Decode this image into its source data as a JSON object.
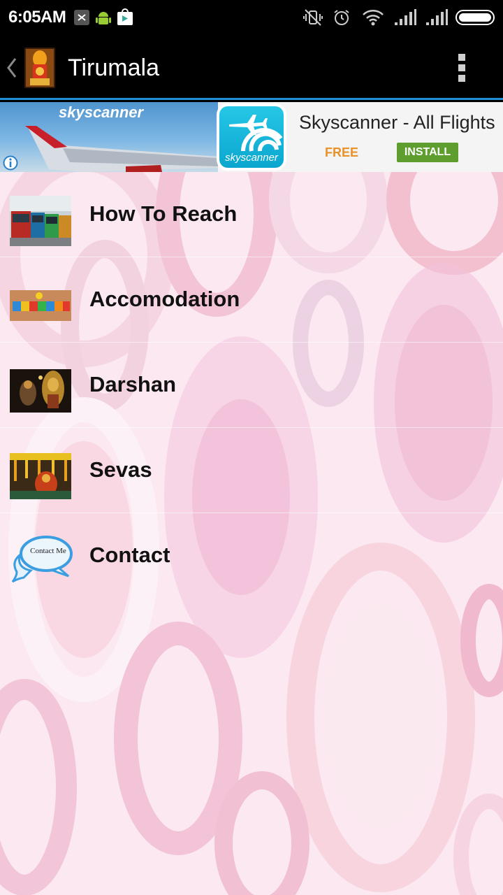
{
  "status_bar": {
    "time": "6:05AM"
  },
  "action_bar": {
    "title": "Tirumala"
  },
  "ad": {
    "brand_logo": "skyscanner",
    "app_icon_text": "skyscanner",
    "title": "Skyscanner - All Flights",
    "price": "FREE",
    "install_label": "INSTALL",
    "colors": {
      "free": "#e8922a",
      "install": "#5e9e2e",
      "icon": "#12b3db"
    }
  },
  "menu": {
    "items": [
      {
        "label": "How To Reach",
        "thumb": "buses-photo"
      },
      {
        "label": "Accomodation",
        "thumb": "accomodation-sign"
      },
      {
        "label": "Darshan",
        "thumb": "temple-deity-photo"
      },
      {
        "label": "Sevas",
        "thumb": "seva-ritual-photo"
      },
      {
        "label": "Contact",
        "thumb": "contact-me-bubble",
        "thumb_text": "Contact Me"
      }
    ]
  },
  "colors": {
    "accent": "#1e8fd4",
    "background": "#fbe8f1"
  }
}
